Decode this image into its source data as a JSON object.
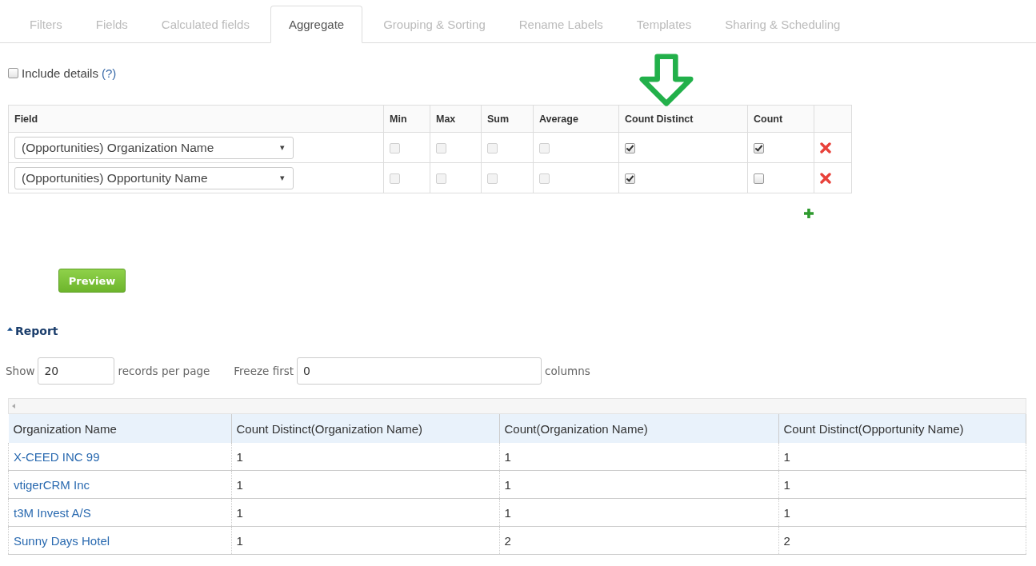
{
  "tabs": [
    {
      "label": "Filters",
      "selected": false
    },
    {
      "label": "Fields",
      "selected": false
    },
    {
      "label": "Calculated fields",
      "selected": false
    },
    {
      "label": "Aggregate",
      "selected": true
    },
    {
      "label": "Grouping & Sorting",
      "selected": false
    },
    {
      "label": "Rename Labels",
      "selected": false
    },
    {
      "label": "Templates",
      "selected": false
    },
    {
      "label": "Sharing & Scheduling",
      "selected": false
    }
  ],
  "include_details": {
    "label": "Include details",
    "help": "(?)",
    "checked": false
  },
  "aggregate": {
    "columns": [
      "Field",
      "Min",
      "Max",
      "Sum",
      "Average",
      "Count Distinct",
      "Count"
    ],
    "rows": [
      {
        "field": "(Opportunities) Organization Name",
        "dropdown": "▾",
        "options": [
          {
            "checked": false,
            "disabled": true
          },
          {
            "checked": false,
            "disabled": true
          },
          {
            "checked": false,
            "disabled": true
          },
          {
            "checked": false,
            "disabled": true
          },
          {
            "checked": true,
            "disabled": false
          },
          {
            "checked": true,
            "disabled": false
          }
        ]
      },
      {
        "field": "(Opportunities) Opportunity Name",
        "dropdown": "▾",
        "options": [
          {
            "checked": false,
            "disabled": true
          },
          {
            "checked": false,
            "disabled": true
          },
          {
            "checked": false,
            "disabled": true
          },
          {
            "checked": false,
            "disabled": true
          },
          {
            "checked": true,
            "disabled": false
          },
          {
            "checked": false,
            "disabled": false
          }
        ]
      }
    ]
  },
  "preview_button": "Preview",
  "report": {
    "title": "Report",
    "show_label": "Show",
    "page_size": "20",
    "records_label": "records per page",
    "freeze_label": "Freeze first",
    "freeze_value": "0",
    "columns_label": "columns",
    "table": {
      "columns": [
        "Organization Name",
        "Count Distinct(Organization Name)",
        "Count(Organization Name)",
        "Count Distinct(Opportunity Name)"
      ],
      "rows": [
        [
          "X-CEED INC 99",
          "1",
          "1",
          "1"
        ],
        [
          "vtigerCRM Inc",
          "1",
          "1",
          "1"
        ],
        [
          "t3M Invest A/S",
          "1",
          "1",
          "1"
        ],
        [
          "Sunny Days Hotel",
          "1",
          "2",
          "2"
        ]
      ]
    }
  }
}
